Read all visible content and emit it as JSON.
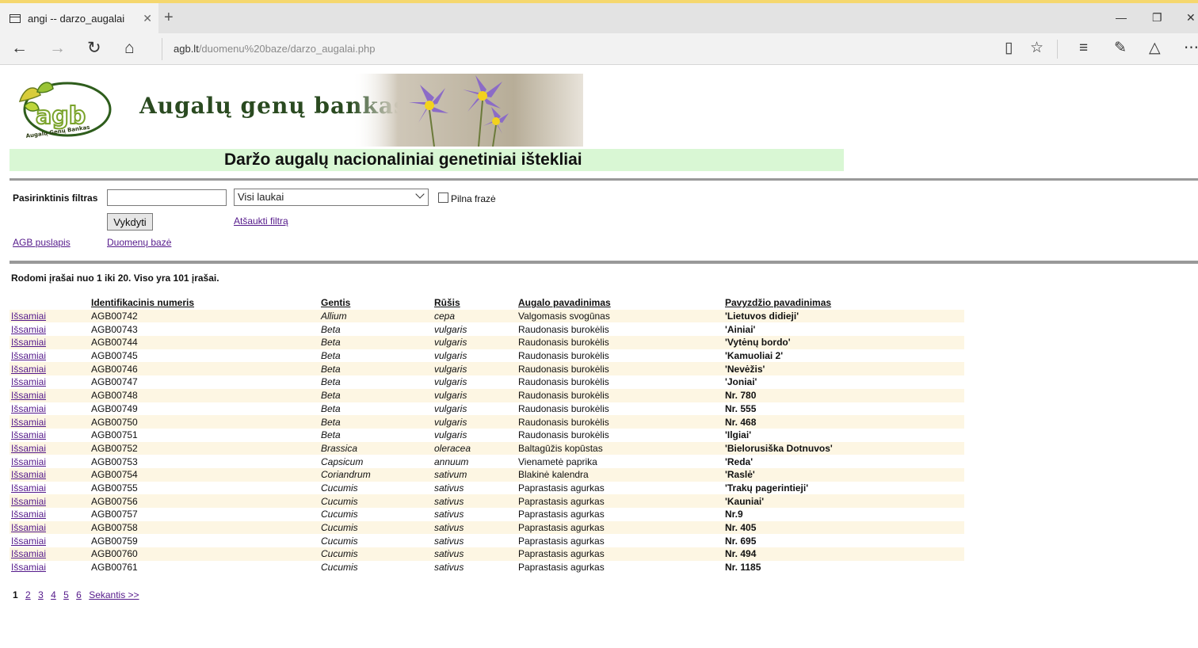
{
  "browser": {
    "tab_title": "angi -- darzo_augalai",
    "url_host": "agb.lt",
    "url_path": "/duomenu%20baze/darzo_augalai.php"
  },
  "header": {
    "brand": "Augalų genų bankas",
    "logo_text": "agb",
    "logo_caption": "Augalų Genų Bankas",
    "title": "Daržo augalų nacionaliniai genetiniai ištekliai"
  },
  "filter": {
    "label": "Pasirinktinis filtras",
    "input_value": "",
    "select_value": "Visi laukai",
    "checkbox_label": "Pilna frazė",
    "submit_label": "Vykdyti",
    "cancel_label": "Atšaukti filtrą",
    "agb_link": "AGB puslapis",
    "db_link": "Duomenų bazė"
  },
  "records_summary": "Rodomi įrašai nuo 1 iki 20. Viso yra 101  įrašai.",
  "table": {
    "columns": [
      "",
      "Identifikacinis numeris",
      "Gentis",
      "Rūšis",
      "Augalo pavadinimas",
      "Pavyzdžio pavadinimas"
    ],
    "detail_label": "Išsamiai",
    "rows": [
      {
        "id": "AGB00742",
        "genus": "Allium",
        "species": "cepa",
        "plant": "Valgomasis svogūnas",
        "sample": "'Lietuvos didieji'"
      },
      {
        "id": "AGB00743",
        "genus": "Beta",
        "species": "vulgaris",
        "plant": "Raudonasis burokėlis",
        "sample": "'Ainiai'"
      },
      {
        "id": "AGB00744",
        "genus": "Beta",
        "species": "vulgaris",
        "plant": "Raudonasis burokėlis",
        "sample": "'Vytėnų bordo'"
      },
      {
        "id": "AGB00745",
        "genus": "Beta",
        "species": "vulgaris",
        "plant": "Raudonasis burokėlis",
        "sample": "'Kamuoliai 2'"
      },
      {
        "id": "AGB00746",
        "genus": "Beta",
        "species": "vulgaris",
        "plant": "Raudonasis burokėlis",
        "sample": "'Nevėžis'"
      },
      {
        "id": "AGB00747",
        "genus": "Beta",
        "species": "vulgaris",
        "plant": "Raudonasis burokėlis",
        "sample": "'Joniai'"
      },
      {
        "id": "AGB00748",
        "genus": "Beta",
        "species": "vulgaris",
        "plant": "Raudonasis burokėlis",
        "sample": "Nr. 780"
      },
      {
        "id": "AGB00749",
        "genus": "Beta",
        "species": "vulgaris",
        "plant": "Raudonasis burokėlis",
        "sample": "Nr. 555"
      },
      {
        "id": "AGB00750",
        "genus": "Beta",
        "species": "vulgaris",
        "plant": "Raudonasis burokėlis",
        "sample": "Nr. 468"
      },
      {
        "id": "AGB00751",
        "genus": "Beta",
        "species": "vulgaris",
        "plant": "Raudonasis burokėlis",
        "sample": "'Ilgiai'"
      },
      {
        "id": "AGB00752",
        "genus": "Brassica",
        "species": "oleracea",
        "plant": "Baltagūžis kopūstas",
        "sample": "'Bielorusiška Dotnuvos'"
      },
      {
        "id": "AGB00753",
        "genus": "Capsicum",
        "species": "annuum",
        "plant": "Vienametė paprika",
        "sample": "'Reda'"
      },
      {
        "id": "AGB00754",
        "genus": "Coriandrum",
        "species": "sativum",
        "plant": "Blakinė kalendra",
        "sample": "'Raslė'"
      },
      {
        "id": "AGB00755",
        "genus": "Cucumis",
        "species": "sativus",
        "plant": "Paprastasis agurkas",
        "sample": "'Trakų pagerintieji'"
      },
      {
        "id": "AGB00756",
        "genus": "Cucumis",
        "species": "sativus",
        "plant": "Paprastasis agurkas",
        "sample": "'Kauniai'"
      },
      {
        "id": "AGB00757",
        "genus": "Cucumis",
        "species": "sativus",
        "plant": "Paprastasis agurkas",
        "sample": "Nr.9"
      },
      {
        "id": "AGB00758",
        "genus": "Cucumis",
        "species": "sativus",
        "plant": "Paprastasis agurkas",
        "sample": "Nr. 405"
      },
      {
        "id": "AGB00759",
        "genus": "Cucumis",
        "species": "sativus",
        "plant": "Paprastasis agurkas",
        "sample": "Nr. 695"
      },
      {
        "id": "AGB00760",
        "genus": "Cucumis",
        "species": "sativus",
        "plant": "Paprastasis agurkas",
        "sample": "Nr. 494"
      },
      {
        "id": "AGB00761",
        "genus": "Cucumis",
        "species": "sativus",
        "plant": "Paprastasis agurkas",
        "sample": "Nr. 1185"
      }
    ]
  },
  "pagination": {
    "current": "1",
    "pages": [
      "2",
      "3",
      "4",
      "5",
      "6"
    ],
    "next": "Sekantis >>"
  },
  "colors": {
    "title_band": "#d9f7d4",
    "row_alt": "#fdf6e3",
    "link": "#551a8b"
  }
}
